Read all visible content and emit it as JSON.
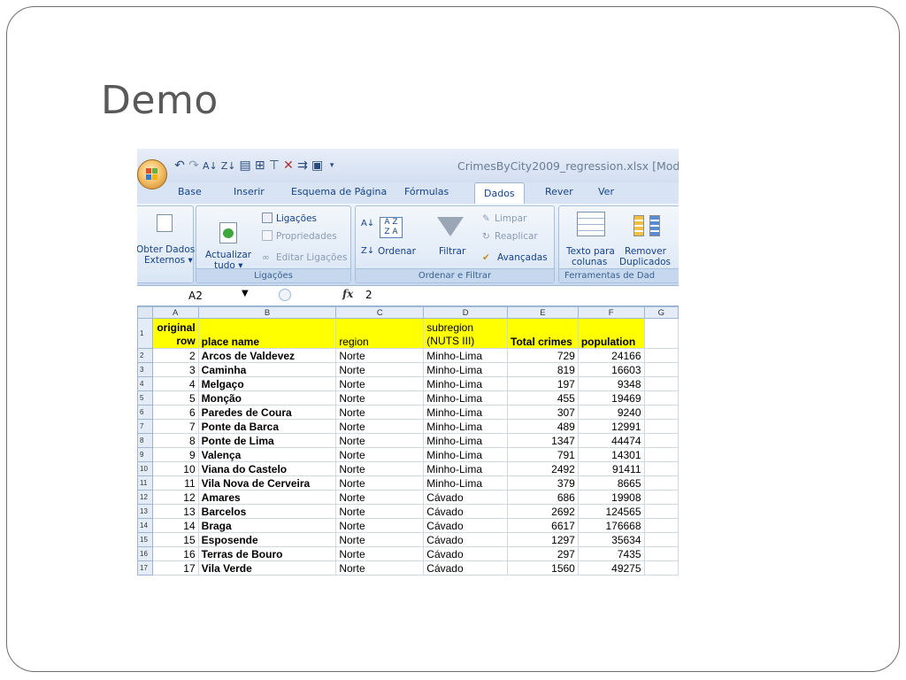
{
  "slide": {
    "title": "Demo"
  },
  "window": {
    "doc_title": "CrimesByCity2009_regression.xlsx  [Mod",
    "qat_icons": [
      "undo-icon",
      "redo-icon",
      "sort-asc-icon",
      "sort-desc-icon",
      "paste-icon",
      "insert-icon",
      "filter-icon",
      "delete-icon",
      "wrap-icon",
      "chart-icon",
      "qat-dropdown-icon"
    ]
  },
  "tabs": [
    "Base",
    "Inserir",
    "Esquema de Página",
    "Fórmulas",
    "Dados",
    "Rever",
    "Ver"
  ],
  "active_tab": "Dados",
  "ribbon": {
    "external": {
      "line1": "Obter Dados",
      "line2": "Externos ▾"
    },
    "refresh": {
      "line1": "Actualizar",
      "line2": "tudo ▾"
    },
    "connections": {
      "links": "Ligações",
      "properties": "Propriedades",
      "edit_links": "Editar Ligações",
      "label": "Ligações"
    },
    "sort": {
      "sort": "Ordenar",
      "filter": "Filtrar",
      "clear": "Limpar",
      "reapply": "Reaplicar",
      "advanced": "Avançadas",
      "label": "Ordenar e Filtrar"
    },
    "tools": {
      "text_to_cols_1": "Texto para",
      "text_to_cols_2": "colunas",
      "remove_1": "Remover",
      "remove_2": "Duplicados",
      "label": "Ferramentas de Dad"
    }
  },
  "formula_bar": {
    "name_box": "A2",
    "fx": "fx",
    "value": "2"
  },
  "sheet": {
    "col_letters": [
      "A",
      "B",
      "C",
      "D",
      "E",
      "F",
      "G"
    ],
    "headers": {
      "a1": "original",
      "a2": "row",
      "b": "place name",
      "c": "region",
      "d1": "subregion",
      "d2": "(NUTS III)",
      "e": "Total crimes",
      "f": "population"
    },
    "rows": [
      {
        "n": "2",
        "a": "2",
        "b": "Arcos de Valdevez",
        "c": "Norte",
        "d": "Minho-Lima",
        "e": "729",
        "f": "24166"
      },
      {
        "n": "3",
        "a": "3",
        "b": "Caminha",
        "c": "Norte",
        "d": "Minho-Lima",
        "e": "819",
        "f": "16603"
      },
      {
        "n": "4",
        "a": "4",
        "b": "Melgaço",
        "c": "Norte",
        "d": "Minho-Lima",
        "e": "197",
        "f": "9348"
      },
      {
        "n": "5",
        "a": "5",
        "b": "Monção",
        "c": "Norte",
        "d": "Minho-Lima",
        "e": "455",
        "f": "19469"
      },
      {
        "n": "6",
        "a": "6",
        "b": "Paredes de Coura",
        "c": "Norte",
        "d": "Minho-Lima",
        "e": "307",
        "f": "9240"
      },
      {
        "n": "7",
        "a": "7",
        "b": "Ponte da Barca",
        "c": "Norte",
        "d": "Minho-Lima",
        "e": "489",
        "f": "12991"
      },
      {
        "n": "8",
        "a": "8",
        "b": "Ponte de Lima",
        "c": "Norte",
        "d": "Minho-Lima",
        "e": "1347",
        "f": "44474"
      },
      {
        "n": "9",
        "a": "9",
        "b": "Valença",
        "c": "Norte",
        "d": "Minho-Lima",
        "e": "791",
        "f": "14301"
      },
      {
        "n": "10",
        "a": "10",
        "b": "Viana do Castelo",
        "c": "Norte",
        "d": "Minho-Lima",
        "e": "2492",
        "f": "91411"
      },
      {
        "n": "11",
        "a": "11",
        "b": "Vila Nova de Cerveira",
        "c": "Norte",
        "d": "Minho-Lima",
        "e": "379",
        "f": "8665"
      },
      {
        "n": "12",
        "a": "12",
        "b": "Amares",
        "c": "Norte",
        "d": "Cávado",
        "e": "686",
        "f": "19908"
      },
      {
        "n": "13",
        "a": "13",
        "b": "Barcelos",
        "c": "Norte",
        "d": "Cávado",
        "e": "2692",
        "f": "124565"
      },
      {
        "n": "14",
        "a": "14",
        "b": "Braga",
        "c": "Norte",
        "d": "Cávado",
        "e": "6617",
        "f": "176668"
      },
      {
        "n": "15",
        "a": "15",
        "b": "Esposende",
        "c": "Norte",
        "d": "Cávado",
        "e": "1297",
        "f": "35634"
      },
      {
        "n": "16",
        "a": "16",
        "b": "Terras de Bouro",
        "c": "Norte",
        "d": "Cávado",
        "e": "297",
        "f": "7435"
      },
      {
        "n": "17",
        "a": "17",
        "b": "Vila Verde",
        "c": "Norte",
        "d": "Cávado",
        "e": "1560",
        "f": "49275"
      }
    ]
  },
  "colors": {
    "header_fill": "#ffff00",
    "ribbon_bg": "#dbe7f5",
    "title_color": "#595959"
  }
}
